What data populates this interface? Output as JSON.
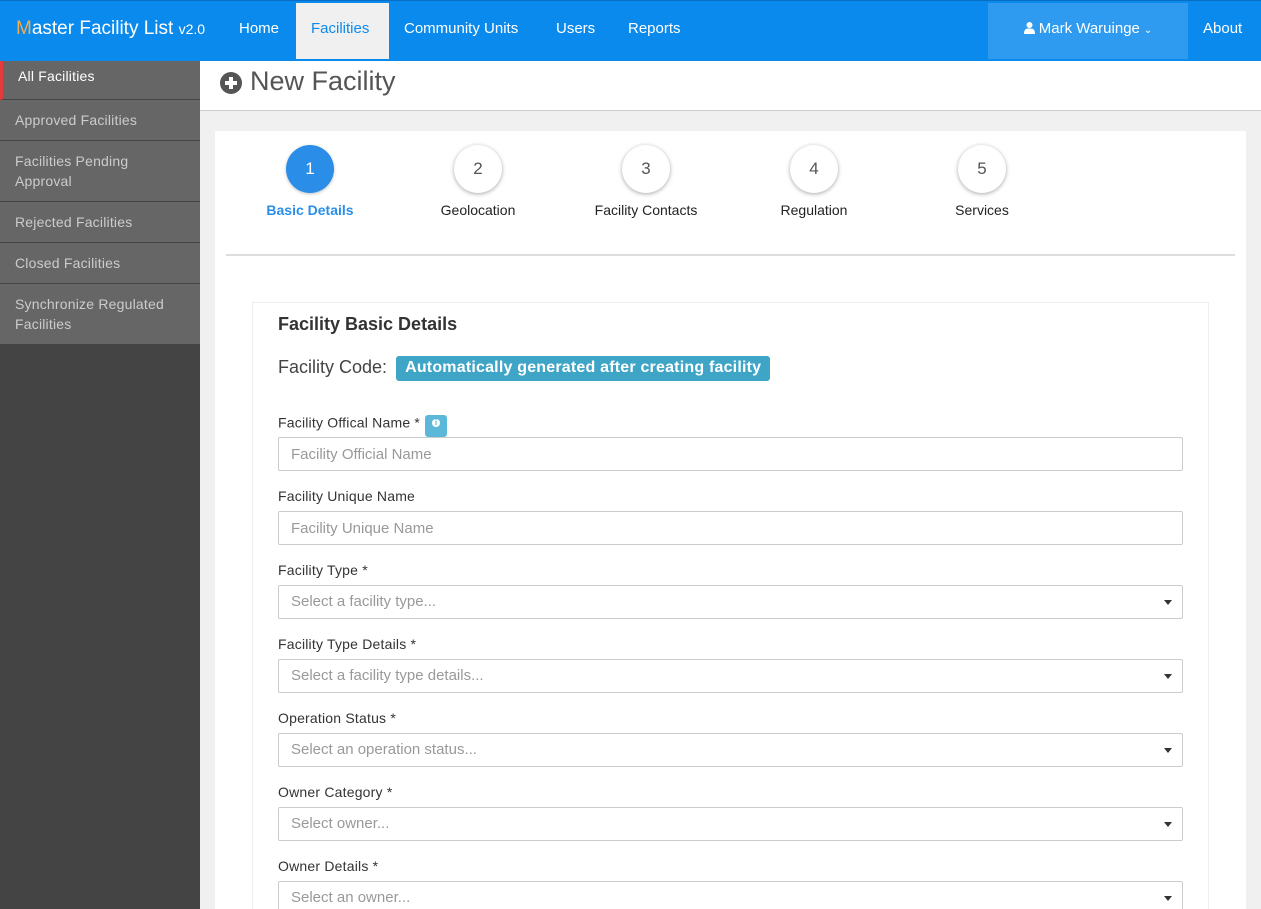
{
  "navbar": {
    "brand_first_letter": "M",
    "brand_rest": "aster Facility List",
    "brand_version": "v2.0",
    "items": [
      {
        "label": "Home"
      },
      {
        "label": "Facilities"
      },
      {
        "label": "Community Units"
      },
      {
        "label": "Users"
      },
      {
        "label": "Reports"
      }
    ],
    "active_item": "Facilities",
    "user_name": "Mark Waruinge",
    "about": "About",
    "colors": {
      "bar": "#0b8aee",
      "brand_accent": "#f0ad4e"
    }
  },
  "sidebar": {
    "items": [
      {
        "label": "All Facilities"
      },
      {
        "label": "Approved Facilities"
      },
      {
        "label": "Facilities Pending Approval"
      },
      {
        "label": "Rejected Facilities"
      },
      {
        "label": "Closed Facilities"
      },
      {
        "label": "Synchronize Regulated Facilities"
      }
    ],
    "active_item": "All Facilities"
  },
  "page": {
    "title": "New Facility",
    "icon": "plus-circle-icon"
  },
  "wizard": {
    "steps": [
      {
        "number": "1",
        "label": "Basic Details"
      },
      {
        "number": "2",
        "label": "Geolocation"
      },
      {
        "number": "3",
        "label": "Facility Contacts"
      },
      {
        "number": "4",
        "label": "Regulation"
      },
      {
        "number": "5",
        "label": "Services"
      }
    ],
    "active_step": "1"
  },
  "form": {
    "title": "Facility Basic Details",
    "code_label": "Facility Code:",
    "code_value": "Automatically generated after creating facility",
    "fields": [
      {
        "label": "Facility Offical Name *",
        "placeholder": "Facility Official Name",
        "kind": "text",
        "info_icon": "info-icon"
      },
      {
        "label": "Facility Unique Name",
        "placeholder": "Facility Unique Name",
        "kind": "text"
      },
      {
        "label": "Facility Type *",
        "placeholder": "Select a facility type...",
        "kind": "select"
      },
      {
        "label": "Facility Type Details *",
        "placeholder": "Select a facility type details...",
        "kind": "select"
      },
      {
        "label": "Operation Status *",
        "placeholder": "Select an operation status...",
        "kind": "select"
      },
      {
        "label": "Owner Category *",
        "placeholder": "Select owner...",
        "kind": "select"
      },
      {
        "label": "Owner Details *",
        "placeholder": "Select an owner...",
        "kind": "select"
      }
    ]
  }
}
